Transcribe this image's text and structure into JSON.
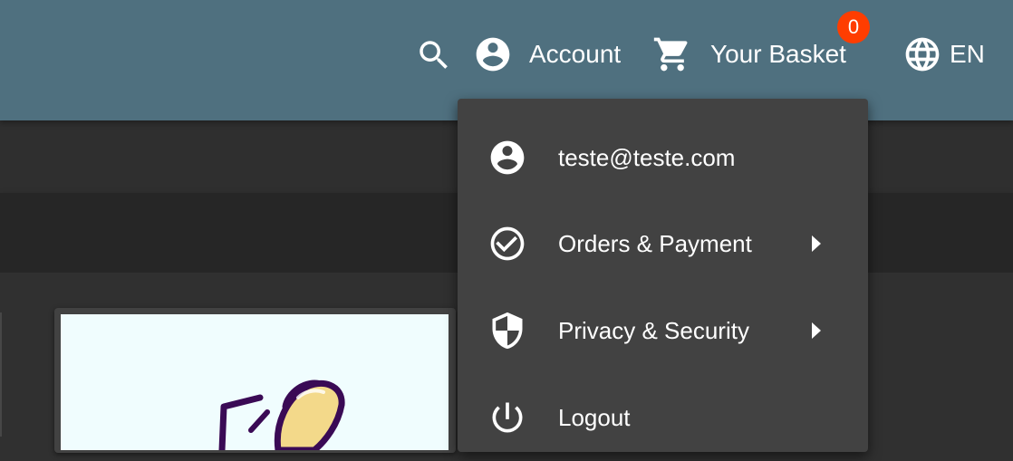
{
  "toolbar": {
    "account_label": "Account",
    "basket_label": "Your Basket",
    "basket_count": "0",
    "language_label": "EN",
    "icons": {
      "search": "search-icon",
      "account": "account-circle-icon",
      "basket": "shopping-cart-icon",
      "language": "globe-icon"
    }
  },
  "account_menu": {
    "items": [
      {
        "label": "teste@teste.com",
        "icon": "account-circle-icon",
        "has_submenu": false
      },
      {
        "label": "Orders & Payment",
        "icon": "check-circle-icon",
        "has_submenu": true
      },
      {
        "label": "Privacy & Security",
        "icon": "shield-icon",
        "has_submenu": true
      },
      {
        "label": "Logout",
        "icon": "power-icon",
        "has_submenu": false
      }
    ]
  },
  "colors": {
    "toolbar_bg": "#4f707f",
    "menu_bg": "#424242",
    "page_bg": "#303030",
    "badge_bg": "#ff3d00"
  }
}
